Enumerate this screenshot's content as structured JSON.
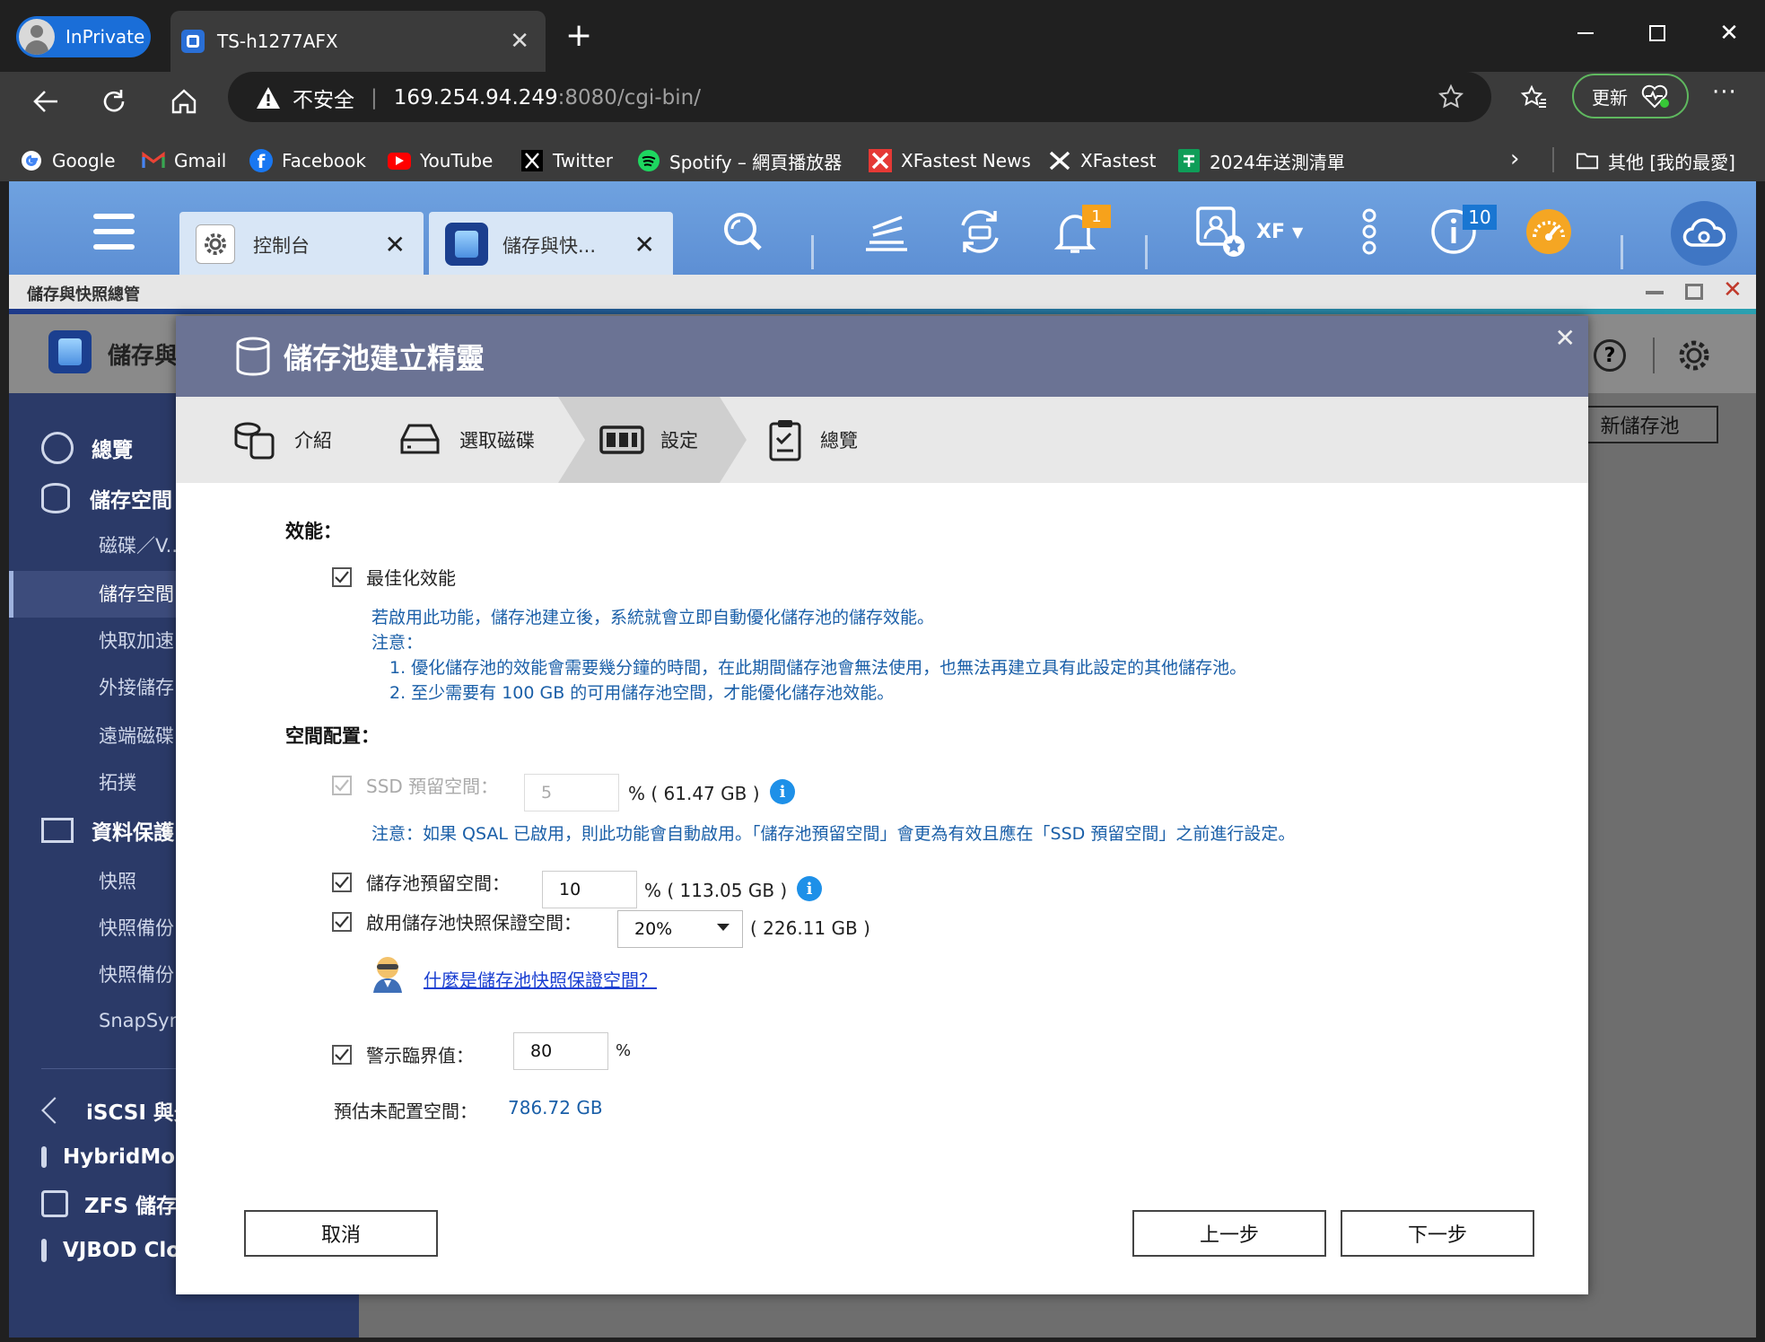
{
  "browser": {
    "inprivate_label": "InPrivate",
    "tab_title": "TS-h1277AFX",
    "address_warning": "不安全",
    "address_host": "169.254.94.249",
    "address_rest": ":8080/cgi-bin/",
    "update_label": "更新",
    "bookmarks": [
      "Google",
      "Gmail",
      "Facebook",
      "YouTube",
      "Twitter",
      "Spotify – 網頁播放器",
      "XFastest News",
      "XFastest",
      "2024年送測清單"
    ],
    "other_bookmarks": "其他 [我的最愛]"
  },
  "qts": {
    "tab1": "控制台",
    "tab2": "儲存與快...",
    "notification_count": "1",
    "info_count": "10",
    "user": "XF"
  },
  "app": {
    "window_title": "儲存與快照總管",
    "header_title": "儲存與",
    "new_pool_button": "新儲存池",
    "sidebar": {
      "overview": "總覽",
      "storage": "儲存空間",
      "disks": "磁碟／V...",
      "pools": "儲存空間",
      "cache": "快取加速",
      "external": "外接儲存",
      "remote": "遠端磁碟",
      "topology": "拓撲",
      "protection": "資料保護",
      "snapshot": "快照",
      "snap_backup1": "快照備份",
      "snap_backup2": "快照備份",
      "snapsync": "SnapSync",
      "iscsi": "iSCSI 與光",
      "hybridmount": "HybridMount",
      "zfs": "ZFS 儲存池",
      "vjbod": "VJBOD Cloud"
    }
  },
  "dialog": {
    "title": "儲存池建立精靈",
    "steps": [
      "介紹",
      "選取磁碟",
      "設定",
      "總覽"
    ],
    "perf_title": "效能：",
    "optimize_label": "最佳化效能",
    "optimize_desc": "若啟用此功能，儲存池建立後，系統就會立即自動優化儲存池的儲存效能。",
    "note_label": "注意：",
    "note1": "1. 優化儲存池的效能會需要幾分鐘的時間，在此期間儲存池會無法使用，也無法再建立具有此設定的其他儲存池。",
    "note2": "2. 至少需要有 100 GB 的可用儲存池空間，才能優化儲存池效能。",
    "space_title": "空間配置：",
    "ssd_label": "SSD 預留空間：",
    "ssd_value": "5",
    "ssd_unit": "% ( 61.47 GB )",
    "ssd_note": "注意：如果 QSAL 已啟用，則此功能會自動啟用。「儲存池預留空間」會更為有效且應在「SSD 預留空間」之前進行設定。",
    "pool_reserve_label": "儲存池預留空間：",
    "pool_reserve_value": "10",
    "pool_reserve_unit": "% ( 113.05 GB )",
    "snap_label": "啟用儲存池快照保證空間：",
    "snap_value": "20%",
    "snap_unit": "( 226.11 GB )",
    "snap_link": "什麼是儲存池快照保證空間？",
    "alert_label": "警示臨界值：",
    "alert_value": "80",
    "alert_unit": "%",
    "estimate_label": "預估未配置空間：",
    "estimate_value": "786.72 GB",
    "cancel": "取消",
    "back": "上一步",
    "next": "下一步"
  }
}
